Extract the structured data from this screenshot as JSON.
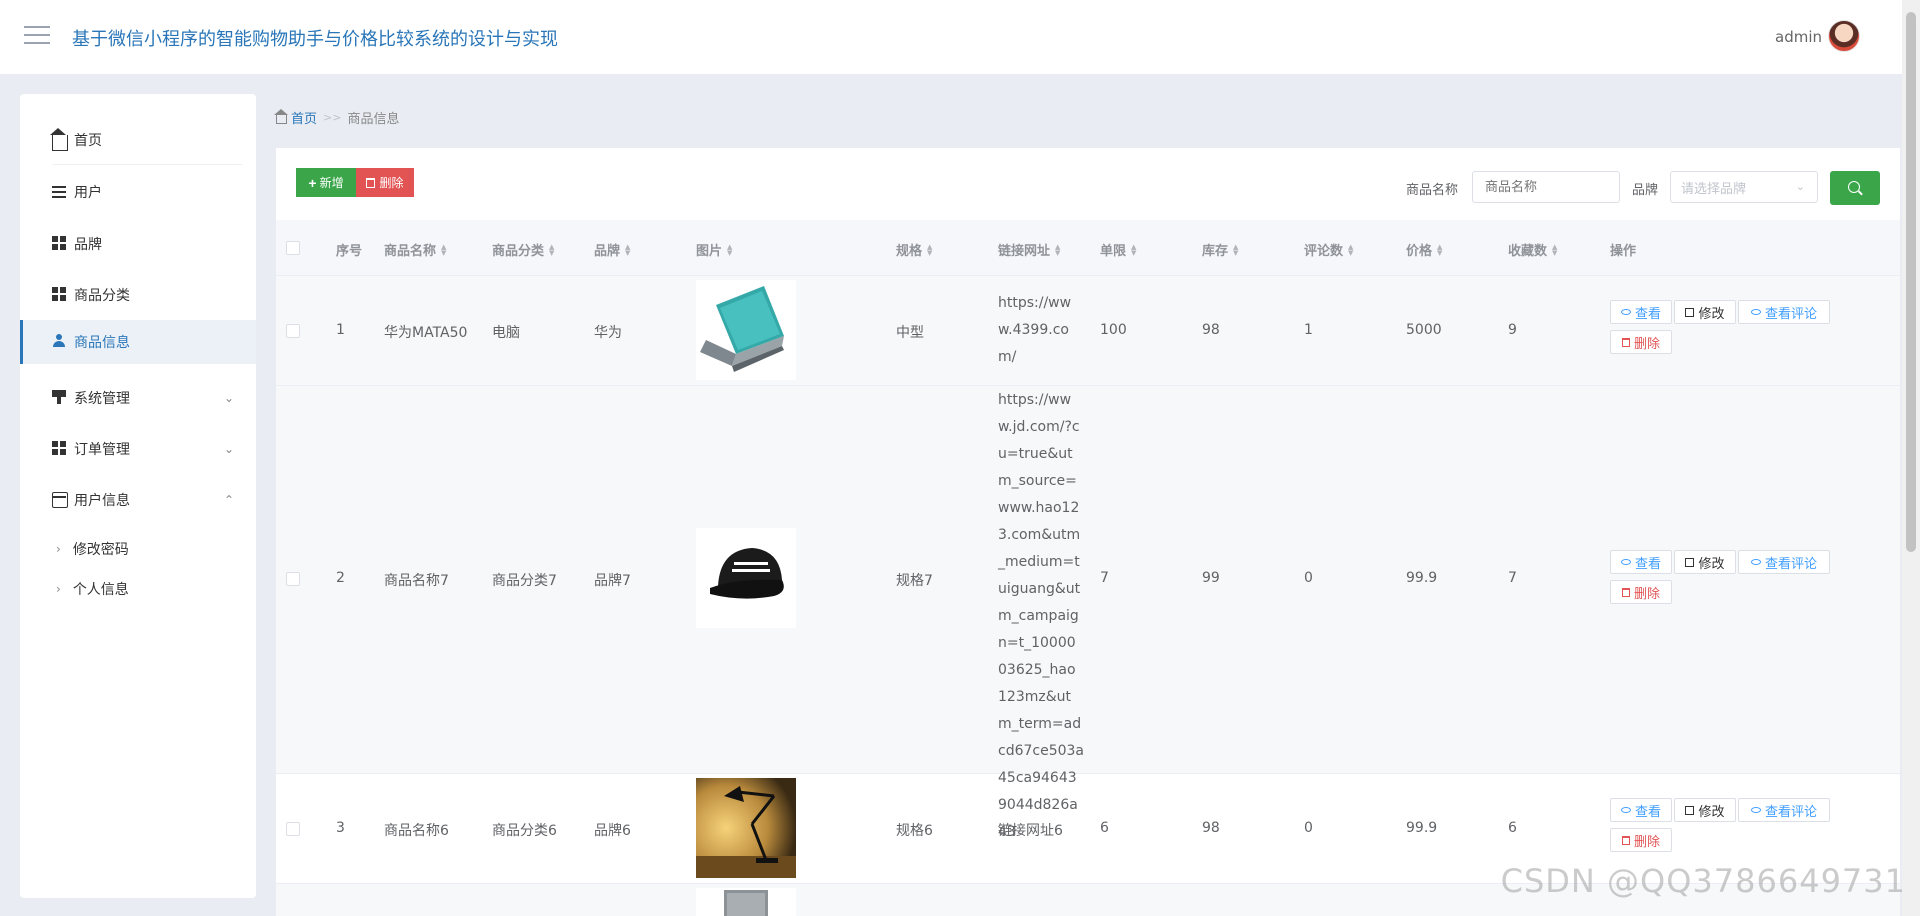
{
  "header": {
    "title": "基于微信小程序的智能购物助手与价格比较系统的设计与实现",
    "user": "admin"
  },
  "sidebar": {
    "items": [
      {
        "label": "首页"
      },
      {
        "label": "用户"
      },
      {
        "label": "品牌"
      },
      {
        "label": "商品分类"
      },
      {
        "label": "商品信息"
      },
      {
        "label": "系统管理"
      },
      {
        "label": "订单管理"
      },
      {
        "label": "用户信息"
      }
    ],
    "sub_items": [
      {
        "label": "修改密码"
      },
      {
        "label": "个人信息"
      }
    ]
  },
  "breadcrumb": {
    "home": "首页",
    "separator": ">>",
    "current": "商品信息"
  },
  "toolbar": {
    "add_label": "新增",
    "delete_label": "删除",
    "name_label": "商品名称",
    "name_placeholder": "商品名称",
    "brand_label": "品牌",
    "brand_placeholder": "请选择品牌"
  },
  "table": {
    "headers": [
      "序号",
      "商品名称",
      "商品分类",
      "品牌",
      "图片",
      "规格",
      "链接网址",
      "单限",
      "库存",
      "评论数",
      "价格",
      "收藏数",
      "操作"
    ],
    "rows": [
      {
        "index": "1",
        "name": "华为MATA50",
        "category": "电脑",
        "brand": "华为",
        "image": "laptop",
        "spec": "中型",
        "url": "https://www.4399.com/",
        "limit": "100",
        "stock": "98",
        "comments": "1",
        "price": "5000",
        "favorites": "9"
      },
      {
        "index": "2",
        "name": "商品名称7",
        "category": "商品分类7",
        "brand": "品牌7",
        "image": "cap",
        "spec": "规格7",
        "url": "https://www.jd.com/?cu=true&utm_source=www.hao123.com&utm_medium=tuiguang&utm_campaign=t_1000003625_hao123mz&utm_term=adcd67ce503a45ca946439044d826a43",
        "limit": "7",
        "stock": "99",
        "comments": "0",
        "price": "99.9",
        "favorites": "7"
      },
      {
        "index": "3",
        "name": "商品名称6",
        "category": "商品分类6",
        "brand": "品牌6",
        "image": "lamp",
        "spec": "规格6",
        "url": "链接网址6",
        "limit": "6",
        "stock": "98",
        "comments": "0",
        "price": "99.9",
        "favorites": "6"
      }
    ],
    "actions": {
      "view": "查看",
      "edit": "修改",
      "view_comments": "查看评论",
      "delete": "删除"
    }
  },
  "watermark": "CSDN @QQ3786649731"
}
